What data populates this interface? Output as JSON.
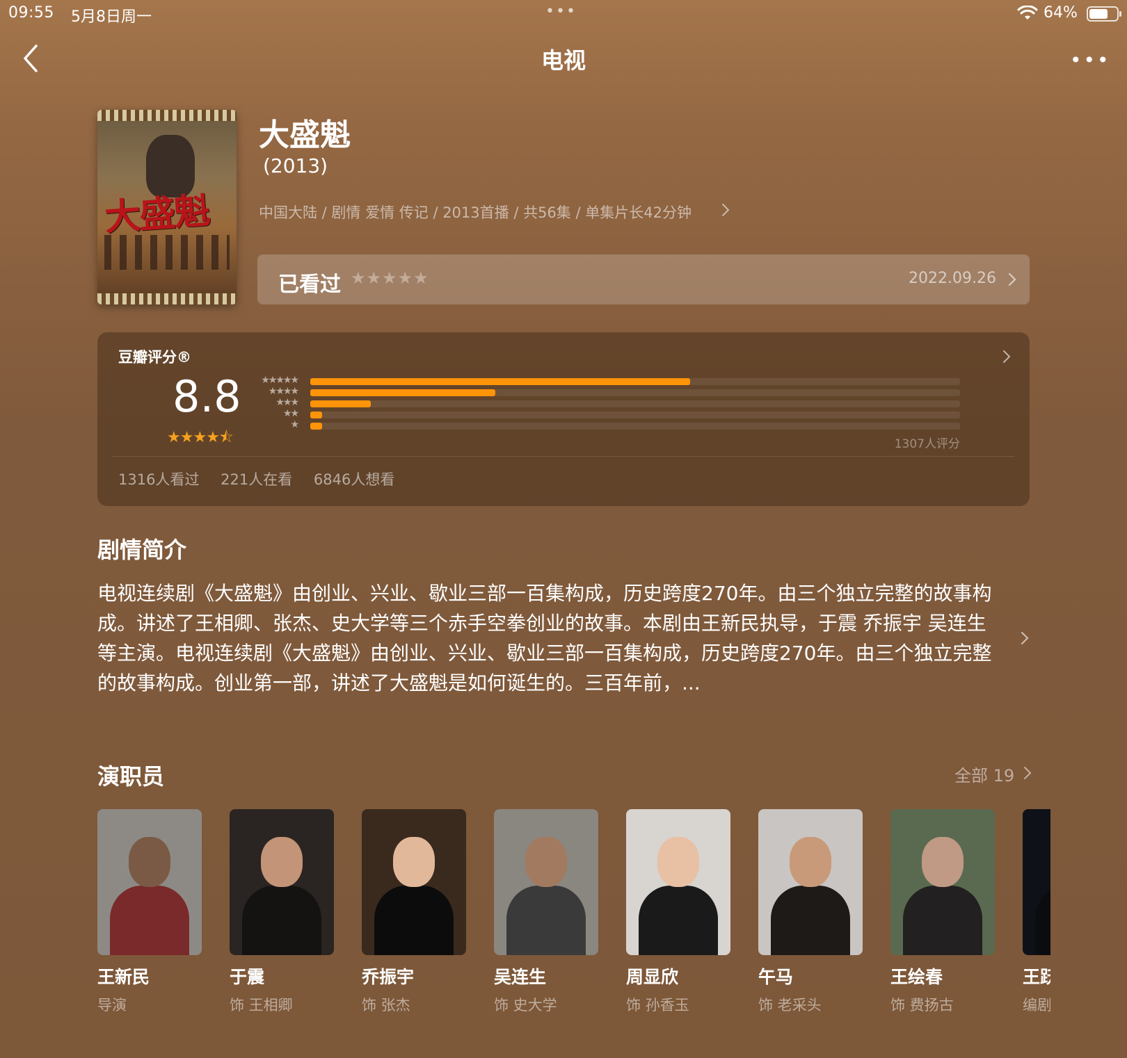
{
  "status_bar": {
    "time": "09:55",
    "date": "5月8日周一",
    "center_dots": "•••",
    "battery": "64%"
  },
  "nav": {
    "title": "电视",
    "more": "•••"
  },
  "show": {
    "title": "大盛魁",
    "year": "(2013)",
    "meta": "中国大陆 / 剧情 爱情 传记 / 2013首播 / 共56集 / 单集片长42分钟",
    "poster_text": "大盛魁"
  },
  "watched": {
    "label": "已看过",
    "stars": "★★★★★",
    "date": "2022.09.26"
  },
  "rating": {
    "label": "豆瓣评分®",
    "score": "8.8",
    "stars": "★★★★⯪",
    "distribution": [
      {
        "stars_label": "★★★★★",
        "fraction": 0.585
      },
      {
        "stars_label": "★★★★",
        "fraction": 0.285
      },
      {
        "stars_label": "★★★",
        "fraction": 0.093
      },
      {
        "stars_label": "★★",
        "fraction": 0.018
      },
      {
        "stars_label": "★",
        "fraction": 0.018
      }
    ],
    "total_raters": "1307人评分",
    "watched_count": "1316人看过",
    "watching_count": "221人在看",
    "want_count": "6846人想看"
  },
  "synopsis": {
    "heading": "剧情简介",
    "text": "电视连续剧《大盛魁》由创业、兴业、歇业三部一百集构成，历史跨度270年。由三个独立完整的故事构成。讲述了王相卿、张杰、史大学等三个赤手空拳创业的故事。本剧由王新民执导，于震 乔振宇 吴连生等主演。电视连续剧《大盛魁》由创业、兴业、歇业三部一百集构成，历史跨度270年。由三个独立完整的故事构成。创业第一部，讲述了大盛魁是如何诞生的。三百年前，..."
  },
  "cast": {
    "heading": "演职员",
    "all_label": "全部 19",
    "members": [
      {
        "name": "王新民",
        "role": "导演",
        "bg": "#8d8a86",
        "skin": "#7a5a44",
        "cloth": "#7a2a2a"
      },
      {
        "name": "于震",
        "role": "饰 王相卿",
        "bg": "#2a2522",
        "skin": "#c49478",
        "cloth": "#151312"
      },
      {
        "name": "乔振宇",
        "role": "饰 张杰",
        "bg": "#3a2a1e",
        "skin": "#e2b89a",
        "cloth": "#0c0c0c"
      },
      {
        "name": "吴连生",
        "role": "饰 史大学",
        "bg": "#8a8680",
        "skin": "#a27a60",
        "cloth": "#3a3a3a"
      },
      {
        "name": "周显欣",
        "role": "饰 孙香玉",
        "bg": "#d8d4d0",
        "skin": "#e8c0a4",
        "cloth": "#1a1a1a"
      },
      {
        "name": "午马",
        "role": "饰 老采头",
        "bg": "#c9c5c2",
        "skin": "#c89a7a",
        "cloth": "#1e1a18"
      },
      {
        "name": "王绘春",
        "role": "饰 费扬古",
        "bg": "#5a6a50",
        "skin": "#c09a84",
        "cloth": "#222020"
      },
      {
        "name": "王跃",
        "role": "编剧",
        "bg": "#0e1218",
        "skin": "#1a1e24",
        "cloth": "#0a0c10"
      }
    ]
  }
}
